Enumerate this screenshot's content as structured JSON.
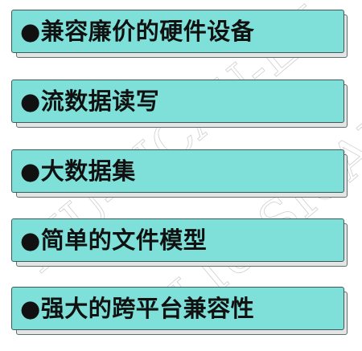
{
  "watermark_text": "LIU-SICAU-LK",
  "items": [
    {
      "label": "●兼容廉价的硬件设备"
    },
    {
      "label": "●流数据读写"
    },
    {
      "label": "●大数据集"
    },
    {
      "label": "●简单的文件模型"
    },
    {
      "label": "●强大的跨平台兼容性"
    }
  ],
  "colors": {
    "box_fill": "#7ee0d8",
    "box_border": "#3b5b5b",
    "shadow_fill": "#e4e4e4",
    "text": "#111111"
  }
}
